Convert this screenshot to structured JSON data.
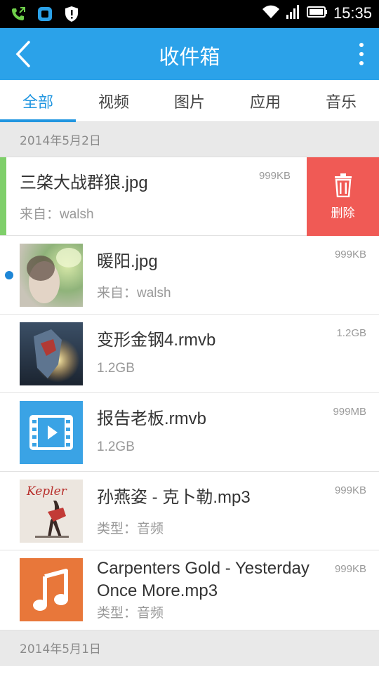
{
  "status_bar": {
    "time": "15:35"
  },
  "header": {
    "title": "收件箱"
  },
  "tabs": [
    {
      "label": "全部",
      "active": true
    },
    {
      "label": "视频",
      "active": false
    },
    {
      "label": "图片",
      "active": false
    },
    {
      "label": "应用",
      "active": false
    },
    {
      "label": "音乐",
      "active": false
    }
  ],
  "sections": [
    {
      "date": "2014年5月2日",
      "items": [
        {
          "name": "三棨大战群狼.jpg",
          "sub": "来自：walsh",
          "size": "999KB",
          "swiped": true,
          "delete_label": "删除"
        },
        {
          "name": "暖阳.jpg",
          "sub": "来自：walsh",
          "size": "999KB",
          "thumb": "photo-thumbnail",
          "unread": true
        },
        {
          "name": "变形金钢4.rmvb",
          "sub": "1.2GB",
          "size": "1.2GB",
          "thumb": "movie-poster-thumbnail"
        },
        {
          "name": "报告老板.rmvb",
          "sub": "1.2GB",
          "size": "999MB",
          "thumb": "video-file-icon"
        },
        {
          "name": "孙燕姿 - 克卜勒.mp3",
          "sub": "类型：音频",
          "size": "999KB",
          "thumb": "album-cover-thumbnail",
          "thumb_text": "Kepler"
        },
        {
          "name": "Carpenters Gold - Yesterday Once More.mp3",
          "sub": "类型：音频",
          "size": "999KB",
          "thumb": "music-file-icon"
        }
      ]
    },
    {
      "date": "2014年5月1日",
      "items": []
    }
  ],
  "colors": {
    "accent": "#2ba2e9",
    "tab_active": "#2196e0",
    "delete": "#f05a55",
    "video_icon_bg": "#3aa3e5",
    "music_icon_bg": "#e8773a"
  }
}
